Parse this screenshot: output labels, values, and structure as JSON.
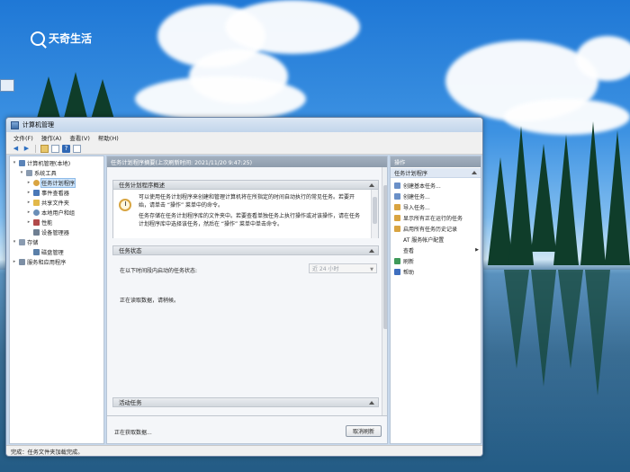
{
  "logo": {
    "text": "天奇生活"
  },
  "window": {
    "title": "计算机管理",
    "menu": [
      "文件(F)",
      "操作(A)",
      "查看(V)",
      "帮助(H)"
    ]
  },
  "tree": {
    "items": [
      {
        "label": "计算机管理(本地)",
        "level": 0,
        "expander": "▾",
        "color": "#5b84b8"
      },
      {
        "label": "系统工具",
        "level": 1,
        "expander": "▾",
        "color": "#8a9bb0"
      },
      {
        "label": "任务计划程序",
        "level": 2,
        "expander": "▸",
        "color": "#d9a441",
        "selected": true
      },
      {
        "label": "事件查看器",
        "level": 2,
        "expander": "▸",
        "color": "#4a78b8"
      },
      {
        "label": "共享文件夹",
        "level": 2,
        "expander": "▸",
        "color": "#e2b84a"
      },
      {
        "label": "本地用户和组",
        "level": 2,
        "expander": "▸",
        "color": "#6a8fb8"
      },
      {
        "label": "性能",
        "level": 2,
        "expander": "▸",
        "color": "#b24a4a"
      },
      {
        "label": "设备管理器",
        "level": 2,
        "expander": "",
        "color": "#6f7f92"
      },
      {
        "label": "存储",
        "level": 0,
        "expander": "▾",
        "color": "#8a9bb0"
      },
      {
        "label": "磁盘管理",
        "level": 1,
        "expander": "",
        "color": "#5b7fa8"
      },
      {
        "label": "服务和应用程序",
        "level": 0,
        "expander": "▸",
        "color": "#7c8ea4"
      }
    ]
  },
  "center": {
    "header": "任务计划程序摘要(上次刷新时间: 2021/11/20 9:47:25)",
    "overview_title": "任务计划程序概述",
    "overview_p1": "可以使用任务计划程序来创建和管理计算机将在所指定的时间自动执行的常见任务。若要开始，请单击 “操作” 菜单中的命令。",
    "overview_p2": "任务存储在任务计划程序库的文件夹中。若要查看单独任务上执行操作或对该操作，请在任务计划程序库中选择该任务，然后在 “操作” 菜单中单击命令。",
    "status_title": "任务状态",
    "status_label": "在以下时间段内启动的任务状态:",
    "status_range": "近 24 小时",
    "reading_text": "正在读取数据，请稍候。",
    "active_title": "活动任务",
    "bottom_text": "正在获取数据...",
    "refresh_label": "取消刷新"
  },
  "actions": {
    "title": "操作",
    "group": "任务计划程序",
    "items": [
      {
        "label": "创建基本任务...",
        "icon": "create-basic-task-icon",
        "color": "#6a90c8"
      },
      {
        "label": "创建任务...",
        "icon": "create-task-icon",
        "color": "#6a90c8"
      },
      {
        "label": "导入任务...",
        "icon": "import-task-icon",
        "color": "#d9a441"
      },
      {
        "label": "显示所有正在运行的任务",
        "icon": "running-tasks-icon",
        "color": "#d9a441"
      },
      {
        "label": "启用所有任务历史记录",
        "icon": "history-icon",
        "color": "#d9a441"
      },
      {
        "label": "AT 服务帐户配置",
        "icon": "",
        "color": ""
      },
      {
        "label": "查看",
        "icon": "",
        "color": "",
        "submenu": true
      },
      {
        "label": "刷新",
        "icon": "refresh-icon",
        "color": "#3f9a5a"
      },
      {
        "label": "帮助",
        "icon": "help-icon",
        "color": "#3f6fbf"
      }
    ]
  },
  "statusbar": {
    "text": "完成：任务文件夹加载完成。"
  }
}
